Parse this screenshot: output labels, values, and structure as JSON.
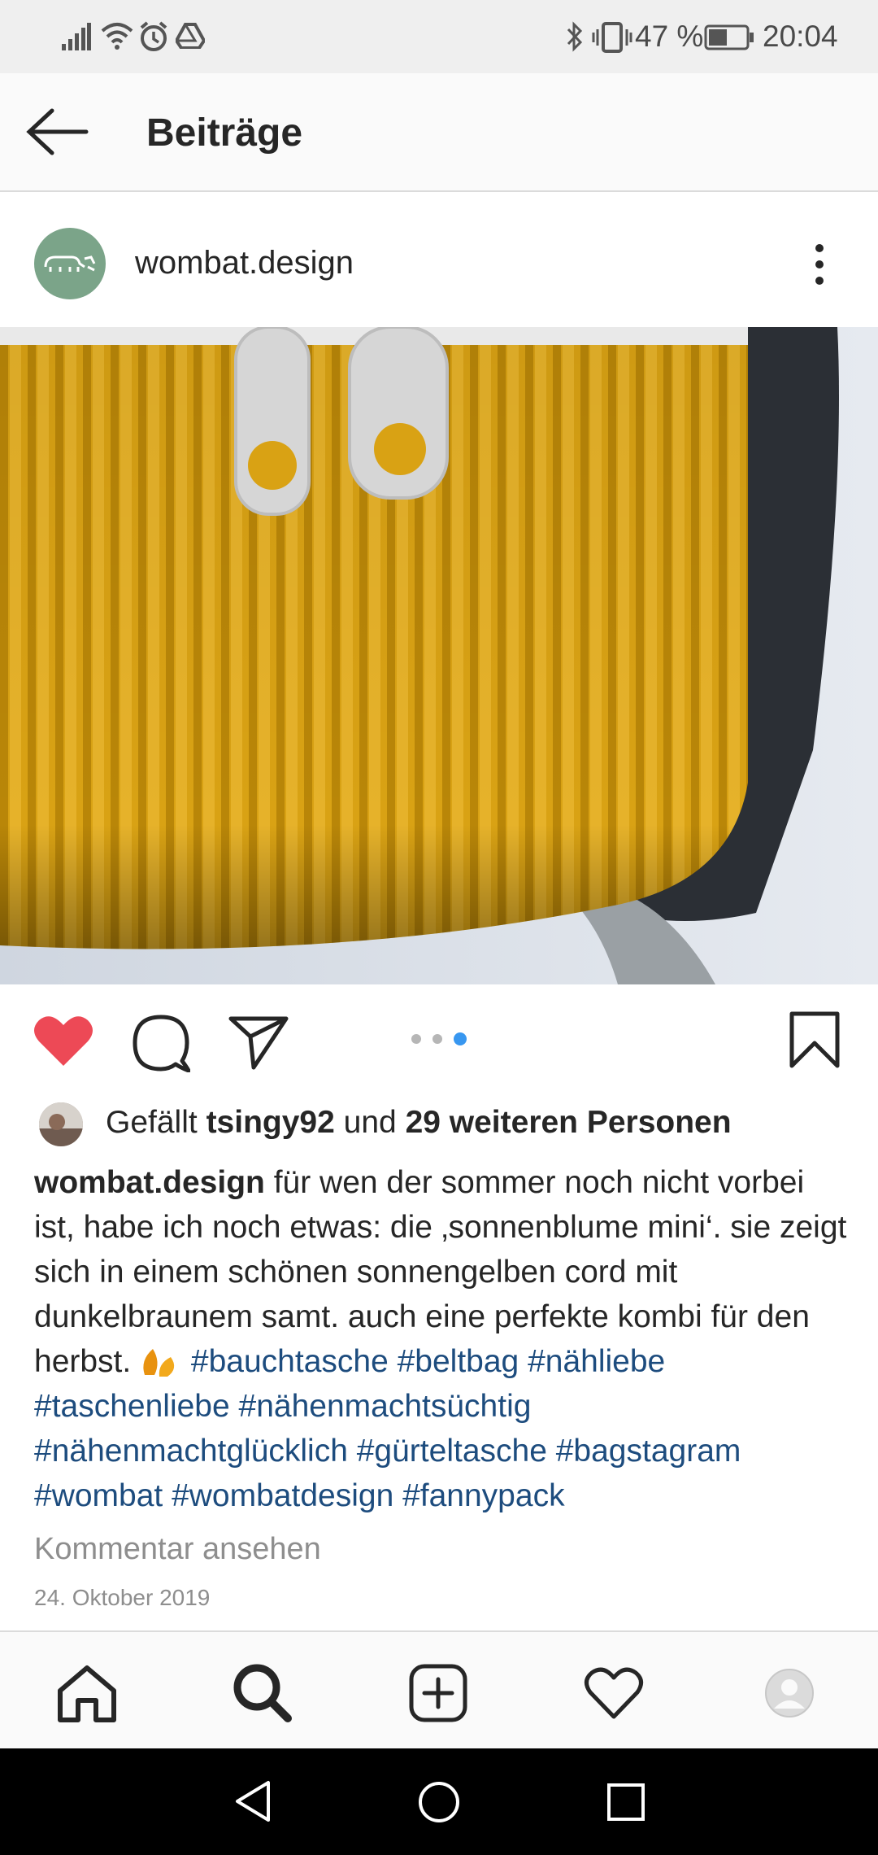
{
  "status_bar": {
    "battery": "47 %",
    "time": "20:04"
  },
  "header": {
    "title": "Beiträge"
  },
  "post": {
    "username": "wombat.design",
    "carousel": {
      "count": 3,
      "active": 3
    },
    "likes": {
      "prefix": "Gefällt",
      "user": "tsingy92",
      "middle": "und",
      "others": "29 weiteren Personen"
    },
    "caption": {
      "username": "wombat.design",
      "text": "für wen der sommer noch nicht vorbei ist, habe ich noch etwas: die ‚sonnenblume mini‘. sie zeigt sich in einem schönen sonnengelben cord mit dunkelbraunem samt. auch eine perfekte kombi für den herbst.",
      "hashtags": "#bauchtasche #beltbag #nähliebe #taschenliebe #nähenmachtsüchtig #nähenmachtglücklich #gürteltasche #bagstagram #wombat #wombatdesign #fannypack"
    },
    "view_comments": "Kommentar ansehen",
    "date": "24. Oktober 2019"
  },
  "colors": {
    "like_red": "#ed4956",
    "hashtag_blue": "#1d4c7e",
    "active_dot": "#3897f0",
    "avatar_green": "#7ba489"
  }
}
